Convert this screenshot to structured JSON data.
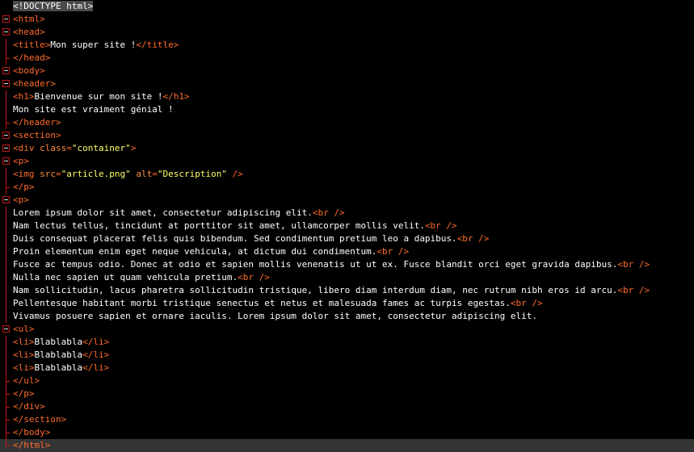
{
  "editor": {
    "lines": [
      {
        "fold": "none",
        "parts": [
          {
            "c": "d",
            "v": "<!DOCTYPE html>"
          }
        ]
      },
      {
        "fold": "open",
        "parts": [
          {
            "c": "t",
            "v": "<html>"
          }
        ]
      },
      {
        "fold": "open",
        "parts": [
          {
            "c": "t",
            "v": "<head>"
          }
        ]
      },
      {
        "fold": "line",
        "parts": [
          {
            "c": "t",
            "v": "<title>"
          },
          {
            "c": "x",
            "v": "Mon super site !"
          },
          {
            "c": "t",
            "v": "</title>"
          }
        ]
      },
      {
        "fold": "end",
        "parts": [
          {
            "c": "t",
            "v": "</head>"
          }
        ]
      },
      {
        "fold": "open",
        "parts": [
          {
            "c": "t",
            "v": "<body>"
          }
        ]
      },
      {
        "fold": "open",
        "parts": [
          {
            "c": "t",
            "v": "<header>"
          }
        ]
      },
      {
        "fold": "line",
        "parts": [
          {
            "c": "t",
            "v": "<h1>"
          },
          {
            "c": "x",
            "v": "Bienvenue sur mon site !"
          },
          {
            "c": "t",
            "v": "</h1>"
          }
        ]
      },
      {
        "fold": "line",
        "parts": [
          {
            "c": "x",
            "v": "Mon site est vraiment génial !"
          }
        ]
      },
      {
        "fold": "end",
        "parts": [
          {
            "c": "t",
            "v": "</header>"
          }
        ]
      },
      {
        "fold": "open",
        "parts": [
          {
            "c": "t",
            "v": "<section>"
          }
        ]
      },
      {
        "fold": "open",
        "parts": [
          {
            "c": "t",
            "v": "<div "
          },
          {
            "c": "a",
            "v": "class"
          },
          {
            "c": "t",
            "v": "="
          },
          {
            "c": "s",
            "v": "\"container\""
          },
          {
            "c": "t",
            "v": ">"
          }
        ]
      },
      {
        "fold": "open",
        "parts": [
          {
            "c": "t",
            "v": "<p>"
          }
        ]
      },
      {
        "fold": "line",
        "parts": [
          {
            "c": "t",
            "v": "<img "
          },
          {
            "c": "a",
            "v": "src"
          },
          {
            "c": "t",
            "v": "="
          },
          {
            "c": "s",
            "v": "\"article.png\""
          },
          {
            "c": "t",
            "v": " "
          },
          {
            "c": "a",
            "v": "alt"
          },
          {
            "c": "t",
            "v": "="
          },
          {
            "c": "s",
            "v": "\"Description\""
          },
          {
            "c": "t",
            "v": " />"
          }
        ]
      },
      {
        "fold": "end",
        "parts": [
          {
            "c": "t",
            "v": "</p>"
          }
        ]
      },
      {
        "fold": "open",
        "parts": [
          {
            "c": "t",
            "v": "<p>"
          }
        ]
      },
      {
        "fold": "line",
        "parts": [
          {
            "c": "x",
            "v": "Lorem ipsum dolor sit amet, consectetur adipiscing elit."
          },
          {
            "c": "t",
            "v": "<br />"
          }
        ]
      },
      {
        "fold": "line",
        "parts": [
          {
            "c": "x",
            "v": "Nam lectus tellus, tincidunt at porttitor sit amet, ullamcorper mollis velit."
          },
          {
            "c": "t",
            "v": "<br />"
          }
        ]
      },
      {
        "fold": "line",
        "parts": [
          {
            "c": "x",
            "v": "Duis consequat placerat felis quis bibendum. Sed condimentum pretium leo a dapibus."
          },
          {
            "c": "t",
            "v": "<br />"
          }
        ]
      },
      {
        "fold": "line",
        "parts": [
          {
            "c": "x",
            "v": "Proin elementum enim eget neque vehicula, at dictum dui condimentum."
          },
          {
            "c": "t",
            "v": "<br />"
          }
        ]
      },
      {
        "fold": "line",
        "parts": [
          {
            "c": "x",
            "v": "Fusce ac tempus odio. Donec at odio et sapien mollis venenatis ut ut ex. Fusce blandit orci eget gravida dapibus."
          },
          {
            "c": "t",
            "v": "<br />"
          }
        ]
      },
      {
        "fold": "line",
        "parts": [
          {
            "c": "x",
            "v": "Nulla nec sapien ut quam vehicula pretium."
          },
          {
            "c": "t",
            "v": "<br />"
          }
        ]
      },
      {
        "fold": "line",
        "parts": [
          {
            "c": "x",
            "v": "Nam sollicitudin, lacus pharetra sollicitudin tristique, libero diam interdum diam, nec rutrum nibh eros id arcu."
          },
          {
            "c": "t",
            "v": "<br />"
          }
        ]
      },
      {
        "fold": "line",
        "parts": [
          {
            "c": "x",
            "v": "Pellentesque habitant morbi tristique senectus et netus et malesuada fames ac turpis egestas."
          },
          {
            "c": "t",
            "v": "<br />"
          }
        ]
      },
      {
        "fold": "line",
        "parts": [
          {
            "c": "x",
            "v": "Vivamus posuere sapien et ornare iaculis. Lorem ipsum dolor sit amet, consectetur adipiscing elit."
          }
        ]
      },
      {
        "fold": "open",
        "parts": [
          {
            "c": "t",
            "v": "<ul>"
          }
        ]
      },
      {
        "fold": "line",
        "parts": [
          {
            "c": "t",
            "v": "<li>"
          },
          {
            "c": "x",
            "v": "Blablabla"
          },
          {
            "c": "t",
            "v": "</li>"
          }
        ]
      },
      {
        "fold": "line",
        "parts": [
          {
            "c": "t",
            "v": "<li>"
          },
          {
            "c": "x",
            "v": "Blablabla"
          },
          {
            "c": "t",
            "v": "</li>"
          }
        ]
      },
      {
        "fold": "line",
        "parts": [
          {
            "c": "t",
            "v": "<li>"
          },
          {
            "c": "x",
            "v": "Blablabla"
          },
          {
            "c": "t",
            "v": "</li>"
          }
        ]
      },
      {
        "fold": "end",
        "parts": [
          {
            "c": "t",
            "v": "</ul>"
          }
        ]
      },
      {
        "fold": "end",
        "parts": [
          {
            "c": "t",
            "v": "</p>"
          }
        ]
      },
      {
        "fold": "end",
        "parts": [
          {
            "c": "t",
            "v": "</div>"
          }
        ]
      },
      {
        "fold": "end",
        "parts": [
          {
            "c": "t",
            "v": "</section>"
          }
        ]
      },
      {
        "fold": "end",
        "parts": [
          {
            "c": "t",
            "v": "</body>"
          }
        ]
      },
      {
        "fold": "endlast",
        "current": true,
        "parts": [
          {
            "c": "t",
            "v": "</html>"
          }
        ]
      }
    ]
  }
}
